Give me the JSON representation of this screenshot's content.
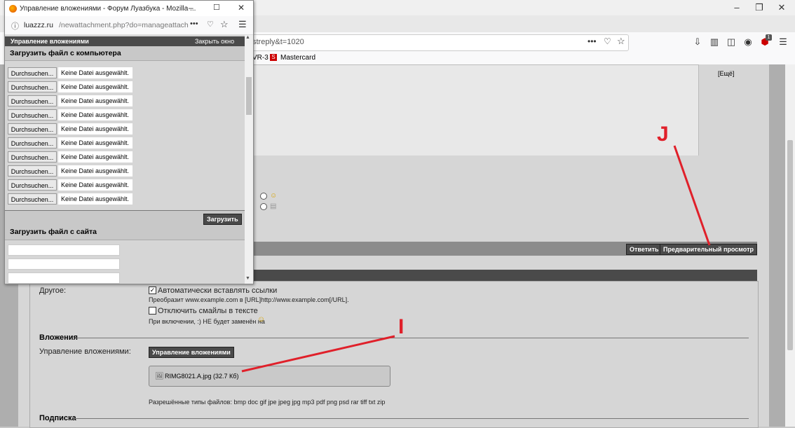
{
  "popup": {
    "title": "Управление вложениями - Форум Луазбука - Mozilla ...",
    "url_host": "luazzz.ru",
    "url_path": "/newattachment.php?do=manageattach",
    "header_title": "Управление вложениями",
    "close_link": "Закрыть окно",
    "upload_computer_heading": "Загрузить файл с компьютера",
    "browse_label": "Durchsuchen...",
    "no_file_label": "Keine Datei ausgewählt.",
    "file_rows": 10,
    "upload_button": "Загрузить",
    "upload_site_heading": "Загрузить файл с сайта"
  },
  "main_browser": {
    "url_fragment": "streply&t=1020",
    "bookmark_partial": "VR-3",
    "bookmark_mastercard": "Mastercard",
    "badge_count": "1",
    "more_link": "[Ещё]"
  },
  "post_buttons": {
    "reply": "Ответить",
    "preview": "Предварительный просмотр"
  },
  "options": {
    "other_label": "Другое:",
    "auto_links_label": "Автоматически вставлять ссылки",
    "auto_links_checked": true,
    "auto_links_hint": "Преобразит www.example.com в [URL]http://www.example.com[/URL].",
    "disable_smilies_label": "Отключить смайлы в тексте",
    "disable_smilies_checked": false,
    "disable_smilies_hint": "При включении, :) НЕ будет заменён на",
    "attachments_heading": "Вложения",
    "manage_attachments_label": "Управление вложениями:",
    "manage_attachments_button": "Управление вложениями",
    "attached_file": "RIMG8021.A.jpg (32.7 Кб)",
    "allowed_types": "Разрешённые типы файлов: bmp doc gif jpe jpeg jpg mp3 pdf png psd rar tiff txt zip",
    "subscription_heading": "Подписка"
  },
  "annotations": {
    "letter_j": "J",
    "letter_i": "I",
    "color": "#e0202a"
  }
}
